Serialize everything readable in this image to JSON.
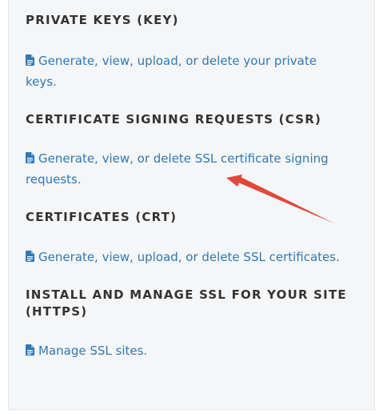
{
  "sections": [
    {
      "title": "PRIVATE KEYS (KEY)",
      "link_line1": "Generate, view, upload, or delete your private",
      "link_line2": "keys.",
      "icon": "file-text-icon"
    },
    {
      "title": "CERTIFICATE SIGNING REQUESTS (CSR)",
      "link_line1": "Generate, view, or delete SSL certificate signing",
      "link_line2": "requests.",
      "icon": "file-text-icon"
    },
    {
      "title": "CERTIFICATES (CRT)",
      "link_line1": "Generate, view, upload, or delete SSL certificates.",
      "icon": "file-text-icon"
    },
    {
      "title_line1": "INSTALL AND MANAGE SSL FOR YOUR SITE",
      "title_line2": "(HTTPS)",
      "link_line1": "Manage SSL sites.",
      "icon": "file-text-icon"
    }
  ],
  "colors": {
    "link": "#2e79b6",
    "heading": "#333333",
    "panel_background": "#f5f6f7",
    "annotation_arrow": "#e2473a"
  }
}
